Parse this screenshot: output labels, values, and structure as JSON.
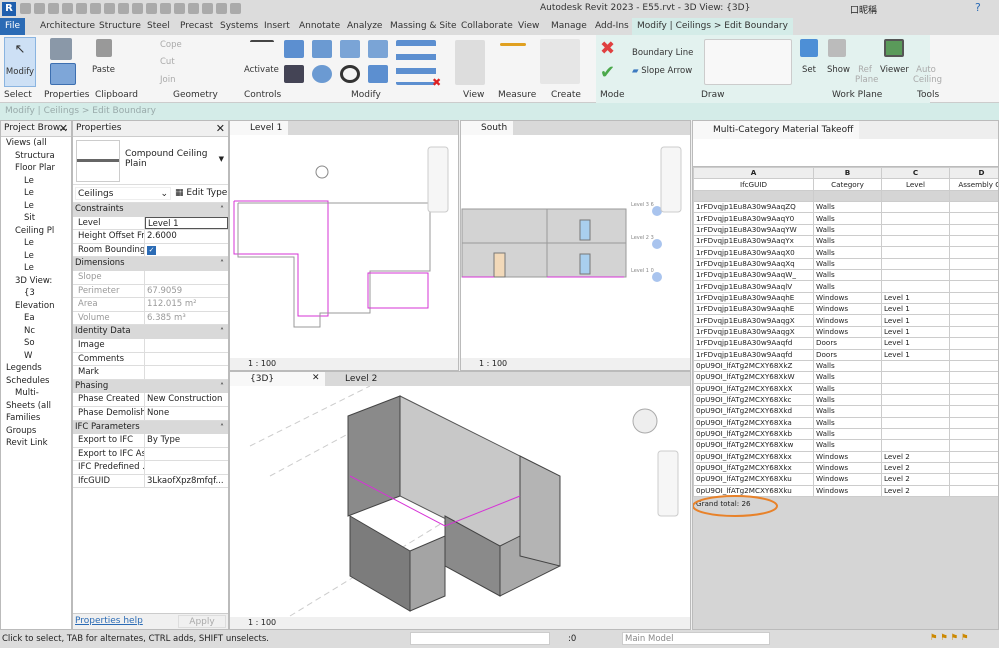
{
  "app": {
    "title": "Autodesk Revit 2023 - E55.rvt - 3D View: {3D}",
    "logo": "R",
    "user": "口昵稱"
  },
  "tabs": [
    "File",
    "Architecture",
    "Structure",
    "Steel",
    "Precast",
    "Systems",
    "Insert",
    "Annotate",
    "Analyze",
    "Massing & Site",
    "Collaborate",
    "View",
    "Manage",
    "Add-Ins",
    "Modify | Ceilings > Edit Boundary"
  ],
  "ribbon": {
    "modify": "Modify",
    "paste": "Paste",
    "cope": "Cope",
    "cut": "Cut",
    "join": "Join",
    "activate": "Activate",
    "boundary_line": "Boundary Line",
    "slope_arrow": "Slope Arrow",
    "set": "Set",
    "show": "Show",
    "ref_plane": "Ref Plane",
    "viewer": "Viewer",
    "auto_ceiling": "Auto Ceiling",
    "panels": [
      "Select",
      "Properties",
      "Clipboard",
      "Geometry",
      "Controls",
      "Modify",
      "View",
      "Measure",
      "Create",
      "Mode",
      "Draw",
      "Work Plane",
      "Tools"
    ]
  },
  "options_bar": "Modify | Ceilings > Edit Boundary",
  "project_browser": {
    "title": "Project Brow...",
    "items": [
      "Views (all",
      "Structura",
      "Floor Plar",
      "Le",
      "Le",
      "Le",
      "Sit",
      "Ceiling Pl",
      "Le",
      "Le",
      "Le",
      "3D View:",
      "{3",
      "Elevation",
      "Ea",
      "Nc",
      "So",
      "W",
      "Legends",
      "Schedules",
      "Multi-",
      "Sheets (all",
      "Families",
      "Groups",
      "Revit Link"
    ]
  },
  "properties": {
    "title": "Properties",
    "type_name": "Compound Ceiling Plain",
    "category": "Ceilings",
    "edit_type": "Edit Type",
    "groups": [
      {
        "name": "Constraints",
        "rows": [
          [
            "Level",
            "Level 1"
          ],
          [
            "Height Offset Fr...",
            "2.6000"
          ],
          [
            "Room Bounding",
            "checked"
          ]
        ]
      },
      {
        "name": "Dimensions",
        "rows": [
          [
            "Slope",
            ""
          ],
          [
            "Perimeter",
            "67.9059"
          ],
          [
            "Area",
            "112.015 m²"
          ],
          [
            "Volume",
            "6.385 m³"
          ]
        ]
      },
      {
        "name": "Identity Data",
        "rows": [
          [
            "Image",
            ""
          ],
          [
            "Comments",
            ""
          ],
          [
            "Mark",
            ""
          ]
        ]
      },
      {
        "name": "Phasing",
        "rows": [
          [
            "Phase Created",
            "New Construction"
          ],
          [
            "Phase Demolish...",
            "None"
          ]
        ]
      },
      {
        "name": "IFC Parameters",
        "rows": [
          [
            "Export to IFC",
            "By Type"
          ],
          [
            "Export to IFC As",
            ""
          ],
          [
            "IFC Predefined ...",
            ""
          ],
          [
            "IfcGUID",
            "3LkaofXpz8mfqf..."
          ]
        ]
      }
    ],
    "help": "Properties help",
    "apply": "Apply"
  },
  "views": {
    "level1": "Level 1",
    "south": "South",
    "3d": "{3D}",
    "level2": "Level 2",
    "scale": "1 : 100",
    "levels": [
      {
        "name": "Level 3",
        "elev": "6"
      },
      {
        "name": "Level 2",
        "elev": "3"
      },
      {
        "name": "Level 1",
        "elev": "0"
      }
    ]
  },
  "schedule": {
    "title": "Multi-Category Material Takeoff",
    "letters": [
      "A",
      "B",
      "C",
      "D"
    ],
    "headers": [
      "IfcGUID",
      "Category",
      "Level",
      "Assembly Co"
    ],
    "rows": [
      [
        "1rFDvqjp1Eu8A30w9AaqZQ",
        "Walls",
        ""
      ],
      [
        "1rFDvqjp1Eu8A30w9AaqY0",
        "Walls",
        ""
      ],
      [
        "1rFDvqjp1Eu8A30w9AaqYW",
        "Walls",
        ""
      ],
      [
        "1rFDvqjp1Eu8A30w9AaqYx",
        "Walls",
        ""
      ],
      [
        "1rFDvqjp1Eu8A30w9AaqX0",
        "Walls",
        ""
      ],
      [
        "1rFDvqjp1Eu8A30w9AaqXq",
        "Walls",
        ""
      ],
      [
        "1rFDvqjp1Eu8A30w9AaqW_",
        "Walls",
        ""
      ],
      [
        "1rFDvqjp1Eu8A30w9AaqlV",
        "Walls",
        ""
      ],
      [
        "1rFDvqjp1Eu8A30w9AaqhE",
        "Windows",
        "Level 1"
      ],
      [
        "1rFDvqjp1Eu8A30w9AaqhE",
        "Windows",
        "Level 1"
      ],
      [
        "1rFDvqjp1Eu8A30w9AaqgX",
        "Windows",
        "Level 1"
      ],
      [
        "1rFDvqjp1Eu8A30w9AaqgX",
        "Windows",
        "Level 1"
      ],
      [
        "1rFDvqjp1Eu8A30w9Aaqfd",
        "Doors",
        "Level 1"
      ],
      [
        "1rFDvqjp1Eu8A30w9Aaqfd",
        "Doors",
        "Level 1"
      ],
      [
        "0pU9OI_lfATg2MCXY68XkZ",
        "Walls",
        ""
      ],
      [
        "0pU9OI_lfATg2MCXY68XkW",
        "Walls",
        ""
      ],
      [
        "0pU9OI_lfATg2MCXY68XkX",
        "Walls",
        ""
      ],
      [
        "0pU9OI_lfATg2MCXY68Xkc",
        "Walls",
        ""
      ],
      [
        "0pU9OI_lfATg2MCXY68Xkd",
        "Walls",
        ""
      ],
      [
        "0pU9OI_lfATg2MCXY68Xka",
        "Walls",
        ""
      ],
      [
        "0pU9OI_lfATg2MCXY68Xkb",
        "Walls",
        ""
      ],
      [
        "0pU9OI_lfATg2MCXY68Xkw",
        "Walls",
        ""
      ],
      [
        "0pU9OI_lfATg2MCXY68Xkx",
        "Windows",
        "Level 2"
      ],
      [
        "0pU9OI_lfATg2MCXY68Xkx",
        "Windows",
        "Level 2"
      ],
      [
        "0pU9OI_lfATg2MCXY68Xku",
        "Windows",
        "Level 2"
      ],
      [
        "0pU9OI_lfATg2MCXY68Xku",
        "Windows",
        "Level 2"
      ]
    ],
    "grand_total": "Grand total: 26"
  },
  "status": {
    "hint": "Click to select, TAB for alternates, CTRL adds, SHIFT unselects.",
    "count": ":0",
    "model": "Main Model"
  },
  "colors": {
    "accent": "#2b6bb5",
    "context_tab": "#d4ece8",
    "sketch": "#d633d6",
    "annotation": "#e8822a"
  }
}
